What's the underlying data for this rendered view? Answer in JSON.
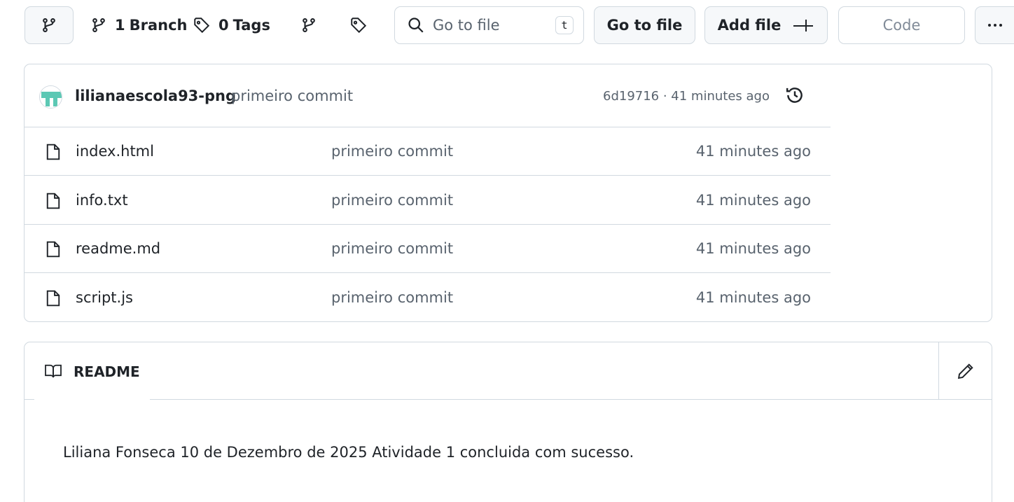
{
  "toolbar": {
    "branch_count": "1",
    "branch_label": "Branch",
    "tag_count": "0",
    "tag_label": "Tags",
    "search_placeholder": "Go to file",
    "search_shortcut": "t",
    "goto_file_label": "Go to file",
    "add_file_label": "Add file",
    "code_label": "Code",
    "more_label": "···"
  },
  "latest_commit": {
    "author": "lilianaescola93-png",
    "message": "primeiro commit",
    "meta": "6d19716 · 41 minutes ago"
  },
  "files": [
    {
      "name": "index.html",
      "message": "primeiro commit",
      "date": "41 minutes ago",
      "icon": "file-icon"
    },
    {
      "name": "info.txt",
      "message": "primeiro commit",
      "date": "41 minutes ago",
      "icon": "file-icon"
    },
    {
      "name": "readme.md",
      "message": "primeiro commit",
      "date": "41 minutes ago",
      "icon": "file-icon"
    },
    {
      "name": "script.js",
      "message": "primeiro commit",
      "date": "41 minutes ago",
      "icon": "file-icon"
    }
  ],
  "readme": {
    "tab_label": "README",
    "content": "Liliana Fonseca 10 de Dezembro de 2025 Atividade 1 concluida com sucesso."
  },
  "colors": {
    "border": "#d1d9e0",
    "muted_text": "#59636e",
    "text": "#1f2328",
    "avatar_accent": "#5cc8b4"
  }
}
